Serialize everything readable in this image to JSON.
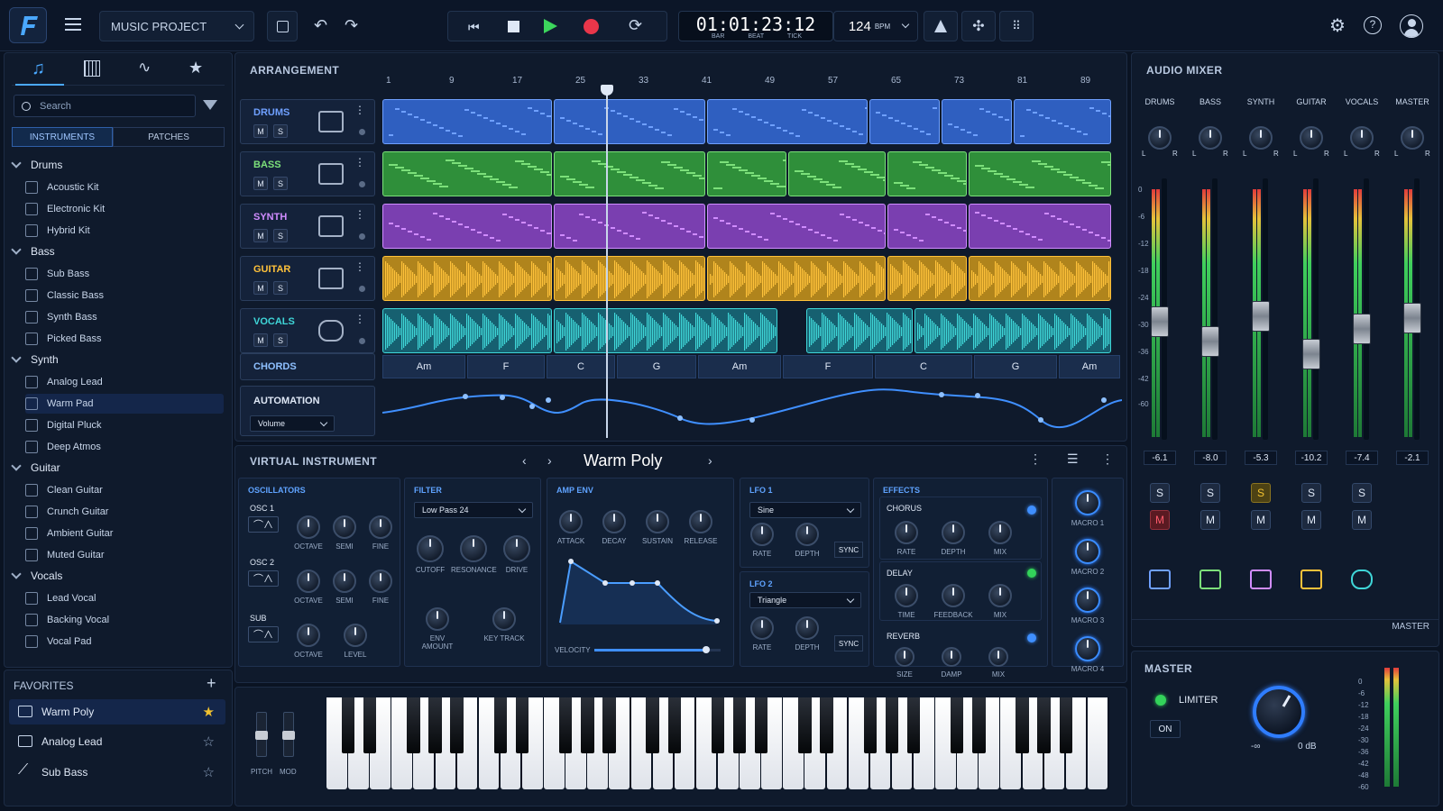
{
  "header": {
    "project": "MUSIC PROJECT",
    "time": "01:01:23:12",
    "time_units": [
      "BAR",
      "BEAT",
      "TICK"
    ],
    "bpm": "124",
    "bpm_unit": "BPM"
  },
  "browser": {
    "search_placeholder": "Search",
    "tabs": [
      "INSTRUMENTS",
      "PATCHES"
    ],
    "categories": [
      {
        "name": "Drums",
        "items": [
          "Acoustic Kit",
          "Electronic Kit",
          "Hybrid Kit"
        ]
      },
      {
        "name": "Bass",
        "items": [
          "Sub Bass",
          "Classic Bass",
          "Synth Bass",
          "Picked Bass"
        ]
      },
      {
        "name": "Synth",
        "items": [
          "Analog Lead",
          "Warm Pad",
          "Digital Pluck",
          "Deep Atmos"
        ]
      },
      {
        "name": "Guitar",
        "items": [
          "Clean Guitar",
          "Crunch Guitar",
          "Ambient Guitar",
          "Muted Guitar"
        ]
      },
      {
        "name": "Vocals",
        "items": [
          "Lead Vocal",
          "Backing Vocal",
          "Vocal Pad"
        ]
      }
    ],
    "selected_item": "Warm Pad"
  },
  "favorites": {
    "title": "FAVORITES",
    "items": [
      "Warm Poly",
      "Analog Lead",
      "Sub Bass"
    ]
  },
  "arrangement": {
    "title": "ARRANGEMENT",
    "bars": [
      "1",
      "9",
      "17",
      "25",
      "33",
      "41",
      "49",
      "57",
      "65",
      "73",
      "81",
      "89"
    ],
    "tracks": [
      {
        "name": "DRUMS",
        "color": "#2f5fc0",
        "accent": "#6fa0ff"
      },
      {
        "name": "BASS",
        "color": "#2f8f3a",
        "accent": "#7ce07a"
      },
      {
        "name": "SYNTH",
        "color": "#7a3fb0",
        "accent": "#d08cff"
      },
      {
        "name": "GUITAR",
        "color": "#b0841c",
        "accent": "#ffc23a"
      },
      {
        "name": "VOCALS",
        "color": "#166070",
        "accent": "#3fd6d8"
      }
    ],
    "mute": "M",
    "solo": "S",
    "chords_label": "CHORDS",
    "chords": [
      "Am",
      "F",
      "C",
      "G",
      "Am",
      "F",
      "C",
      "G",
      "Am"
    ],
    "automation_label": "AUTOMATION",
    "automation_param": "Volume"
  },
  "mixer": {
    "title": "AUDIO MIXER",
    "channels": [
      {
        "name": "DRUMS",
        "db": "-6.1"
      },
      {
        "name": "BASS",
        "db": "-8.0"
      },
      {
        "name": "SYNTH",
        "db": "-5.3"
      },
      {
        "name": "GUITAR",
        "db": "-10.2"
      },
      {
        "name": "VOCALS",
        "db": "-7.4"
      },
      {
        "name": "MASTER",
        "db": "-2.1"
      }
    ],
    "scale": [
      "0",
      "-6",
      "-12",
      "-18",
      "-24",
      "-30",
      "-36",
      "-42",
      "-60"
    ],
    "pan_l": "L",
    "pan_r": "R",
    "master_label": "MASTER"
  },
  "master": {
    "title": "MASTER",
    "limiter": "LIMITER",
    "on": "ON",
    "min": "-∞",
    "max": "0 dB",
    "scale": [
      "0",
      "-6",
      "-12",
      "-18",
      "-24",
      "-30",
      "-36",
      "-42",
      "-48",
      "-60"
    ]
  },
  "instrument": {
    "title": "VIRTUAL INSTRUMENT",
    "preset": "Warm Poly",
    "osc": {
      "title": "OSCILLATORS",
      "osc1": "OSC 1",
      "osc2": "OSC 2",
      "sub": "SUB",
      "labels": [
        "OCTAVE",
        "SEMI",
        "FINE"
      ],
      "sub_labels": [
        "OCTAVE",
        "LEVEL"
      ]
    },
    "filter": {
      "title": "FILTER",
      "type": "Low Pass 24",
      "labels": [
        "CUTOFF",
        "RESONANCE",
        "DRIVE"
      ],
      "labels2": [
        "ENV AMOUNT",
        "KEY TRACK"
      ]
    },
    "amp": {
      "title": "AMP ENV",
      "labels": [
        "ATTACK",
        "DECAY",
        "SUSTAIN",
        "RELEASE"
      ],
      "velocity": "VELOCITY"
    },
    "lfo1": {
      "title": "LFO 1",
      "wave": "Sine",
      "labels": [
        "RATE",
        "DEPTH"
      ],
      "sync": "SYNC"
    },
    "lfo2": {
      "title": "LFO 2",
      "wave": "Triangle",
      "labels": [
        "RATE",
        "DEPTH"
      ],
      "sync": "SYNC"
    },
    "effects": {
      "title": "EFFECTS",
      "chorus": "CHORUS",
      "chorus_labels": [
        "RATE",
        "DEPTH",
        "MIX"
      ],
      "delay": "DELAY",
      "delay_labels": [
        "TIME",
        "FEEDBACK",
        "MIX"
      ],
      "reverb": "REVERB",
      "reverb_labels": [
        "SIZE",
        "DAMP",
        "MIX"
      ]
    },
    "macros": [
      "MACRO 1",
      "MACRO 2",
      "MACRO 3",
      "MACRO 4"
    ],
    "pitch": "PITCH",
    "mod": "MOD"
  }
}
